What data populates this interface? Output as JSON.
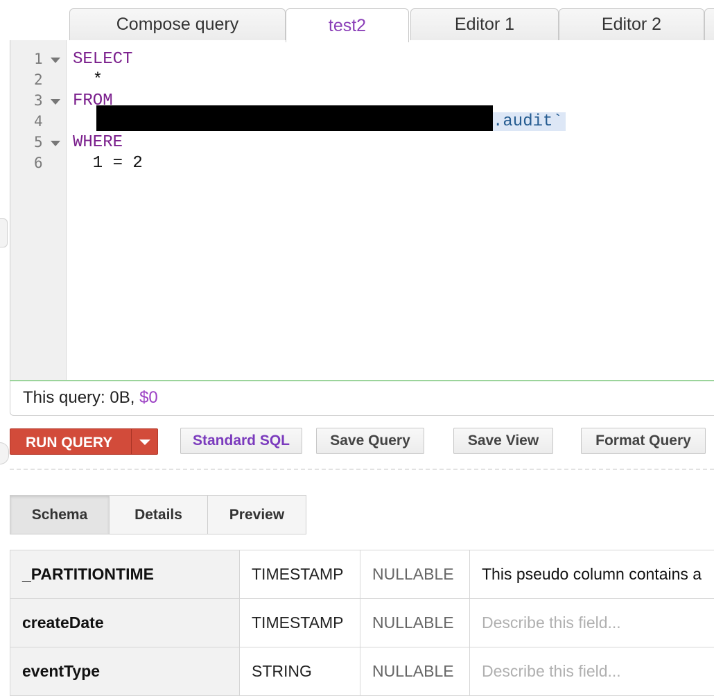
{
  "tabs": [
    {
      "label": "Compose query",
      "active": false
    },
    {
      "label": "test2",
      "active": true
    },
    {
      "label": "Editor 1",
      "active": false
    },
    {
      "label": "Editor 2",
      "active": false
    }
  ],
  "editor": {
    "line_numbers": [
      "1",
      "2",
      "3",
      "4",
      "5",
      "6"
    ],
    "lines": {
      "l1": "SELECT",
      "l2": "  *",
      "l3": "FROM",
      "l4_suffix": ".audit`",
      "l5": "WHERE",
      "l6": "  1 = 2"
    }
  },
  "status": {
    "prefix": "This query: 0B, ",
    "cost": "$0"
  },
  "toolbar": {
    "run_label": "RUN QUERY",
    "standard_sql": "Standard SQL",
    "save_query": "Save Query",
    "save_view": "Save View",
    "format_query": "Format Query"
  },
  "subtabs": [
    {
      "label": "Schema",
      "active": true
    },
    {
      "label": "Details",
      "active": false
    },
    {
      "label": "Preview",
      "active": false
    }
  ],
  "schema": {
    "rows": [
      {
        "name": "_PARTITIONTIME",
        "type": "TIMESTAMP",
        "mode": "NULLABLE",
        "description": "This pseudo column contains a"
      },
      {
        "name": "createDate",
        "type": "TIMESTAMP",
        "mode": "NULLABLE",
        "description": "Describe this field..."
      },
      {
        "name": "eventType",
        "type": "STRING",
        "mode": "NULLABLE",
        "description": "Describe this field..."
      }
    ]
  },
  "colors": {
    "keyword": "#7a1e8c",
    "active_tab": "#8b3fb8",
    "run_button": "#d24b3a",
    "cost": "#9b3fc4"
  }
}
